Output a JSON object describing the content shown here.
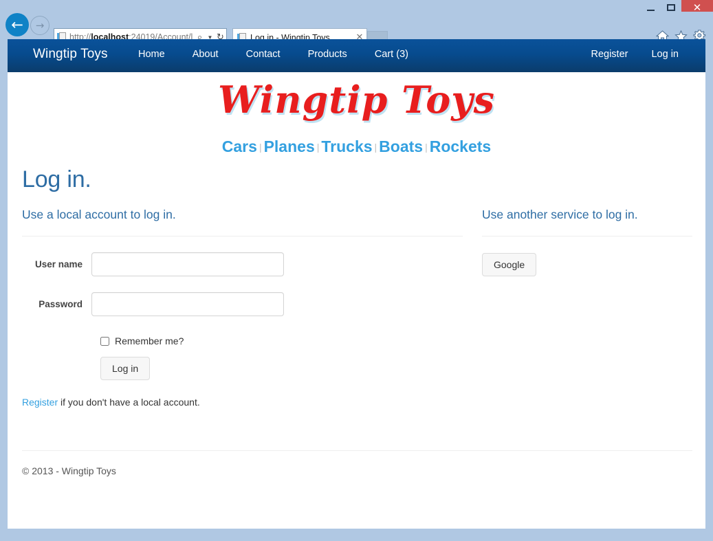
{
  "browser": {
    "window_controls": {
      "minimize": "minimize-button",
      "maximize": "maximize-button",
      "close_label": "✕"
    },
    "back_glyph": "←",
    "forward_glyph": "→",
    "address": {
      "scheme": "http://",
      "host": "localhost",
      "rest": ":24019/Account/l",
      "search_glyph": "⌕",
      "caret_glyph": "▼",
      "refresh_glyph": "↻"
    },
    "tab": {
      "title": "Log in - Wingtip Toys",
      "close_glyph": "✕"
    },
    "toolbar_icons": [
      "home-icon",
      "favorites-icon",
      "settings-icon"
    ]
  },
  "site": {
    "brand": "Wingtip Toys",
    "nav": [
      {
        "label": "Home"
      },
      {
        "label": "About"
      },
      {
        "label": "Contact"
      },
      {
        "label": "Products"
      },
      {
        "label": "Cart (3)"
      }
    ],
    "nav_right": [
      {
        "label": "Register"
      },
      {
        "label": "Log in"
      }
    ],
    "logo_text": "Wingtip Toys",
    "categories": [
      {
        "label": "Cars"
      },
      {
        "label": "Planes"
      },
      {
        "label": "Trucks"
      },
      {
        "label": "Boats"
      },
      {
        "label": "Rockets"
      }
    ],
    "category_separator": "|"
  },
  "page": {
    "title": "Log in.",
    "local": {
      "heading": "Use a local account to log in.",
      "username_label": "User name",
      "username_value": "",
      "username_placeholder": "",
      "password_label": "Password",
      "password_value": "",
      "password_placeholder": "",
      "remember_label": "Remember me?",
      "remember_checked": false,
      "submit_label": "Log in",
      "register_link": "Register",
      "register_text": " if you don't have a local account."
    },
    "external": {
      "heading": "Use another service to log in.",
      "providers": [
        {
          "label": "Google"
        }
      ]
    }
  },
  "footer": {
    "text": "© 2013 - Wingtip Toys"
  },
  "colors": {
    "navbar_top": "#0a529a",
    "navbar_bottom": "#0a3c6b",
    "link_blue": "#33a0e0",
    "heading_blue": "#2e6da4",
    "logo_red": "#e81e1e",
    "logo_shadow": "#bfe2f2",
    "chrome_blue": "#b0c8e3",
    "close_red": "#d0504f"
  }
}
